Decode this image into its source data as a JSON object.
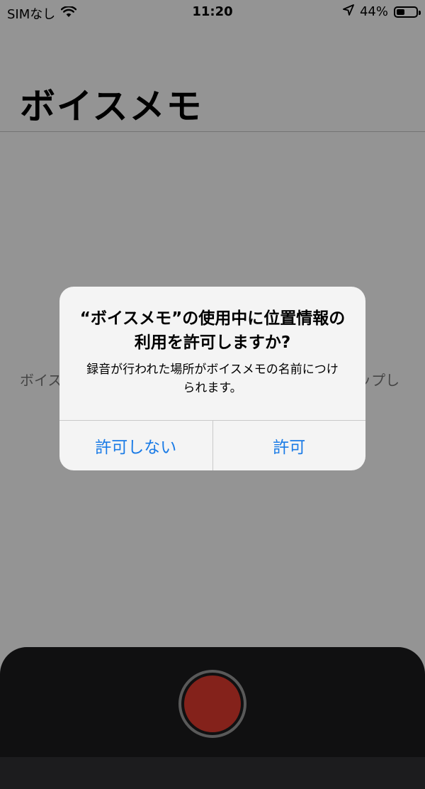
{
  "status_bar": {
    "carrier": "SIMなし",
    "time": "11:20",
    "battery_percent": "44%",
    "battery_level": 0.44,
    "icons": [
      "wifi-icon",
      "location-arrow-icon",
      "battery-icon"
    ]
  },
  "app": {
    "title": "ボイスメモ",
    "empty_hint_visible_left": "ボイス",
    "empty_hint_visible_right": "ップし"
  },
  "alert": {
    "title": "“ボイスメモ”の使用中に位置情報の利用を許可しますか?",
    "message": "録音が行われた場所がボイスメモの名前につけられます。",
    "buttons": {
      "deny": "許可しない",
      "allow": "許可"
    }
  },
  "record_button": {
    "icon": "record-icon"
  },
  "colors": {
    "accent": "#1a7be6",
    "record": "#e33b2f",
    "bottom_panel": "#1c1c1e"
  }
}
